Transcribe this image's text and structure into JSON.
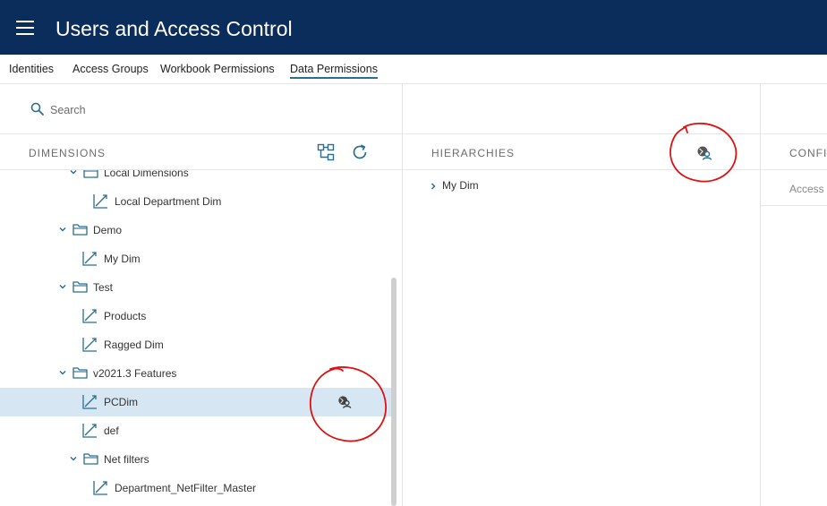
{
  "app": {
    "title": "Users and Access Control"
  },
  "tabs": [
    "Identities",
    "Access Groups",
    "Workbook Permissions",
    "Data Permissions"
  ],
  "active_tab": "Data Permissions",
  "search": {
    "placeholder": "Search"
  },
  "dimensions": {
    "title": "DIMENSIONS",
    "tree": [
      {
        "type": "folder",
        "label": "Local Dimensions",
        "expanded": true
      },
      {
        "type": "dimension",
        "label": "Local Department Dim"
      },
      {
        "type": "folder",
        "label": "Demo",
        "expanded": true
      },
      {
        "type": "dimension",
        "label": "My Dim"
      },
      {
        "type": "folder",
        "label": "Test",
        "expanded": true
      },
      {
        "type": "dimension",
        "label": "Products"
      },
      {
        "type": "dimension",
        "label": "Ragged Dim"
      },
      {
        "type": "folder",
        "label": "v2021.3 Features",
        "expanded": true
      },
      {
        "type": "dimension",
        "label": "PCDim",
        "selected": true
      },
      {
        "type": "dimension",
        "label": "def"
      },
      {
        "type": "folder",
        "label": "Net filters",
        "expanded": true
      },
      {
        "type": "dimension",
        "label": "Department_NetFilter_Master"
      }
    ]
  },
  "hierarchies": {
    "title": "HIERARCHIES",
    "items": [
      "My Dim"
    ]
  },
  "config": {
    "title": "CONFI",
    "sub": "Access C"
  },
  "colors": {
    "header_bg": "#0b2d5b",
    "accent": "#2b6f8f",
    "selected_row": "#d6e6f2",
    "annotation": "#e01010"
  }
}
